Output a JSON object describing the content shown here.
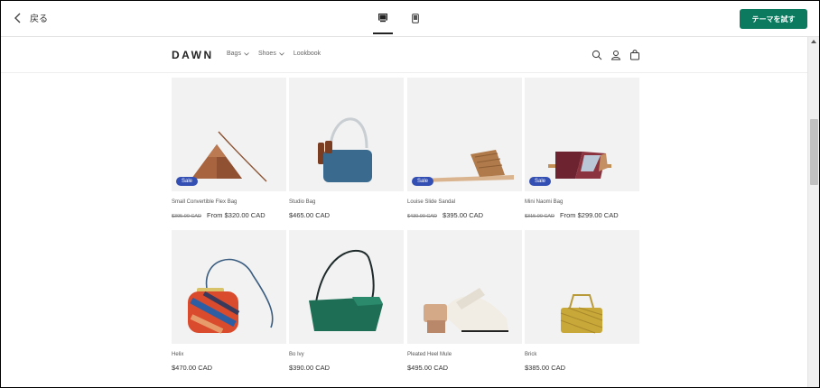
{
  "editor": {
    "back_label": "戻る",
    "cta_label": "テーマを試す",
    "views": [
      "desktop-view",
      "mobile-view"
    ]
  },
  "store": {
    "logo": "DAWN",
    "nav": [
      {
        "label": "Bags",
        "has_dropdown": true
      },
      {
        "label": "Shoes",
        "has_dropdown": true
      },
      {
        "label": "Lookbook",
        "has_dropdown": false
      }
    ]
  },
  "products": [
    {
      "title": "Small Convertible Flex Bag",
      "old_price": "$395.00 CAD",
      "price": "From $320.00 CAD",
      "sale": "Sale"
    },
    {
      "title": "Studio Bag",
      "old_price": "",
      "price": "$465.00 CAD",
      "sale": ""
    },
    {
      "title": "Louise Slide Sandal",
      "old_price": "$430.00 CAD",
      "price": "$395.00 CAD",
      "sale": "Sale"
    },
    {
      "title": "Mini Naomi Bag",
      "old_price": "$315.00 CAD",
      "price": "From $299.00 CAD",
      "sale": "Sale"
    },
    {
      "title": "Helix",
      "old_price": "",
      "price": "$470.00 CAD",
      "sale": ""
    },
    {
      "title": "Bo Ivy",
      "old_price": "",
      "price": "$390.00 CAD",
      "sale": ""
    },
    {
      "title": "Pleated Heel Mule",
      "old_price": "",
      "price": "$495.00 CAD",
      "sale": ""
    },
    {
      "title": "Brick",
      "old_price": "",
      "price": "$385.00 CAD",
      "sale": ""
    }
  ],
  "colors": {
    "accent": "#0b7a5f",
    "sale_badge": "#334fb4"
  }
}
